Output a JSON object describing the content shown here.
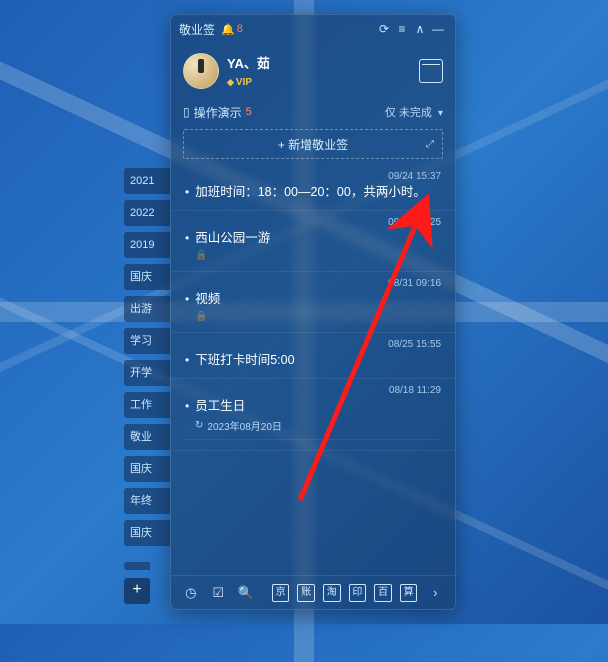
{
  "app": {
    "name": "敬业签",
    "notif_count": "8"
  },
  "profile": {
    "username": "YA、茹",
    "vip_label": "VIP"
  },
  "filter": {
    "category_label": "操作演示",
    "category_count": "5",
    "status_prefix": "仅",
    "status_label": "未完成"
  },
  "add_button": {
    "label": "+ 新增敬业签"
  },
  "notes": [
    {
      "timestamp": "09/24 15:37",
      "text": "加班时间：18：00—20：00，共两小时。",
      "has_lock": false,
      "has_sub": false
    },
    {
      "timestamp": "09/05 09:25",
      "text": "西山公园一游",
      "has_lock": true,
      "has_sub": false
    },
    {
      "timestamp": "08/31 09:16",
      "text": "视频",
      "has_lock": true,
      "has_sub": false
    },
    {
      "timestamp": "08/25 15:55",
      "text": "下班打卡时间5:00",
      "has_lock": false,
      "has_sub": false
    },
    {
      "timestamp": "08/18 11:29",
      "text": "员工生日",
      "has_lock": false,
      "has_sub": true,
      "sub_text": "2023年08月20日"
    }
  ],
  "side_tabs": [
    "2021",
    "2022",
    "2019",
    "国庆",
    "出游",
    "学习",
    "开学",
    "工作",
    "敬业",
    "国庆",
    "年终",
    "国庆"
  ],
  "side_add": "+",
  "footer_shortcuts": [
    "京",
    "账",
    "淘",
    "印",
    "百",
    "算"
  ]
}
